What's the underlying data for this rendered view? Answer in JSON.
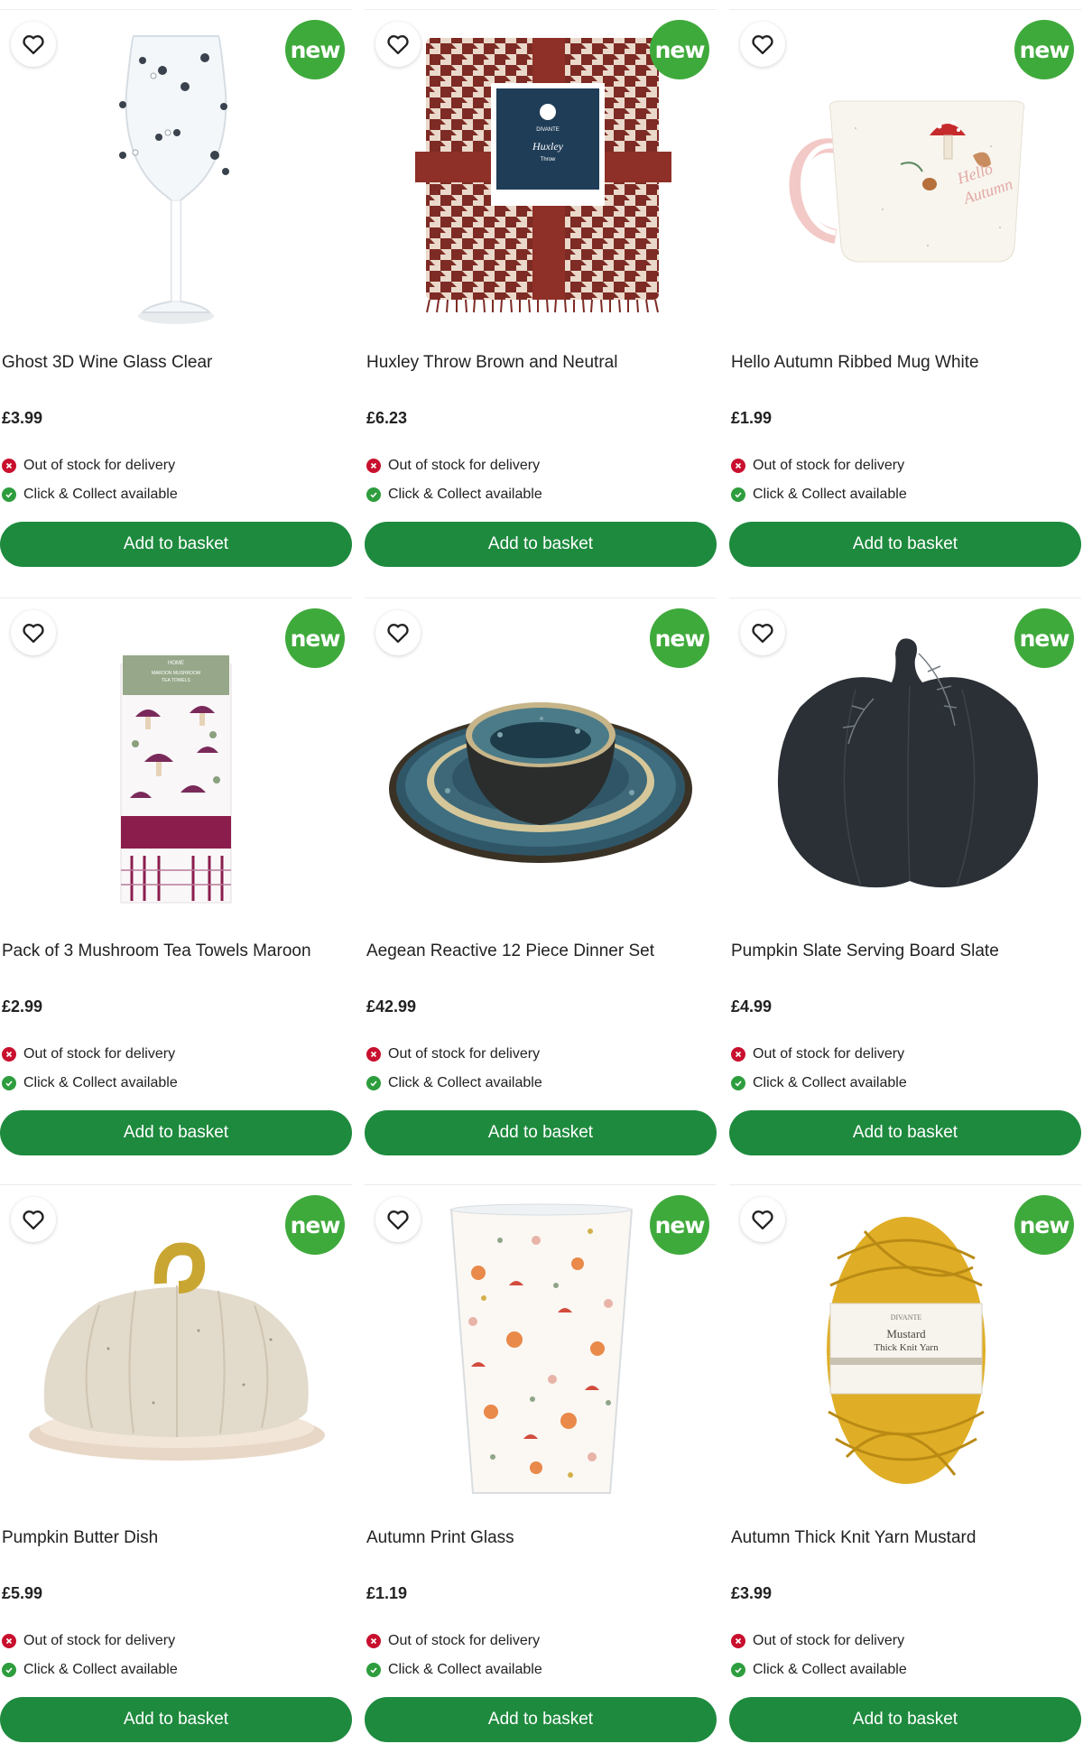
{
  "colors": {
    "brand_green": "#1e8a3e",
    "badge_green": "#3faa3c",
    "out_of_stock_red": "#c8102e",
    "available_green": "#2e9d3e"
  },
  "common": {
    "badge_text": "new",
    "favourite_icon": "heart-outline-icon",
    "delivery_icon": "cross-circle-icon",
    "collect_icon": "check-circle-icon"
  },
  "products": [
    {
      "title": "Ghost 3D Wine Glass Clear",
      "price": "£3.99",
      "delivery_status": "Out of stock for delivery",
      "collect_status": "Click & Collect available",
      "button_label": "Add to basket",
      "image": "ghost-wine-glass-image"
    },
    {
      "title": "Huxley Throw Brown and Neutral",
      "price": "£6.23",
      "delivery_status": "Out of stock for delivery",
      "collect_status": "Click & Collect available",
      "button_label": "Add to basket",
      "image": "houndstooth-throw-image",
      "label_text": [
        "DIVANTE",
        "Huxley",
        "Throw"
      ]
    },
    {
      "title": "Hello Autumn Ribbed Mug White",
      "price": "£1.99",
      "delivery_status": "Out of stock for delivery",
      "collect_status": "Click & Collect available",
      "button_label": "Add to basket",
      "image": "mushroom-mug-image",
      "label_text": [
        "Hello",
        "Autumn"
      ]
    },
    {
      "title": "Pack of 3 Mushroom Tea Towels Maroon",
      "price": "£2.99",
      "delivery_status": "Out of stock for delivery",
      "collect_status": "Click & Collect available",
      "button_label": "Add to basket",
      "image": "tea-towels-image",
      "label_text": [
        "HOME",
        "MAROON MUSHROOM",
        "TEA TOWELS"
      ]
    },
    {
      "title": "Aegean Reactive 12 Piece Dinner Set",
      "price": "£42.99",
      "delivery_status": "Out of stock for delivery",
      "collect_status": "Click & Collect available",
      "button_label": "Add to basket",
      "image": "dinner-set-image"
    },
    {
      "title": "Pumpkin Slate Serving Board Slate",
      "price": "£4.99",
      "delivery_status": "Out of stock for delivery",
      "collect_status": "Click & Collect available",
      "button_label": "Add to basket",
      "image": "pumpkin-slate-board-image"
    },
    {
      "title": "Pumpkin Butter Dish",
      "price": "£5.99",
      "delivery_status": "Out of stock for delivery",
      "collect_status": "Click & Collect available",
      "button_label": "Add to basket",
      "image": "pumpkin-butter-dish-image"
    },
    {
      "title": "Autumn Print Glass",
      "price": "£1.19",
      "delivery_status": "Out of stock for delivery",
      "collect_status": "Click & Collect available",
      "button_label": "Add to basket",
      "image": "autumn-print-glass-image"
    },
    {
      "title": "Autumn Thick Knit Yarn Mustard",
      "price": "£3.99",
      "delivery_status": "Out of stock for delivery",
      "collect_status": "Click & Collect available",
      "button_label": "Add to basket",
      "image": "mustard-yarn-image",
      "label_text": [
        "DIVANTE",
        "Mustard",
        "Thick Knit Yarn"
      ]
    }
  ]
}
